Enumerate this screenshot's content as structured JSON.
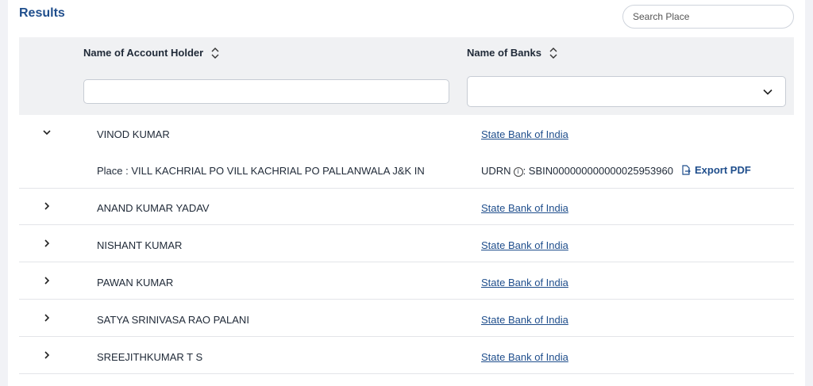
{
  "header": {
    "title": "Results",
    "search_placeholder": "Search Place"
  },
  "table": {
    "columns": [
      "Name of Account Holder",
      "Name of Banks"
    ],
    "expanded_row": {
      "name": "VINOD KUMAR",
      "bank": "State Bank of India",
      "place": "Place : VILL KACHRIAL PO VILL KACHRIAL PO PALLANWALA J&K IN",
      "udrn_label": "UDRN",
      "udrn_value": ": SBIN000000000000025953960",
      "export_label": "Export PDF"
    },
    "rows": [
      {
        "name": "ANAND KUMAR YADAV",
        "bank": "State Bank of India"
      },
      {
        "name": "NISHANT KUMAR",
        "bank": "State Bank of India"
      },
      {
        "name": "PAWAN KUMAR",
        "bank": "State Bank of India"
      },
      {
        "name": "SATYA SRINIVASA RAO PALANI",
        "bank": "State Bank of India"
      },
      {
        "name": "SREEJITHKUMAR T S",
        "bank": "State Bank of India"
      }
    ]
  },
  "colors": {
    "accent": "#1f4e8c",
    "header_bg": "#f0f1f3"
  }
}
